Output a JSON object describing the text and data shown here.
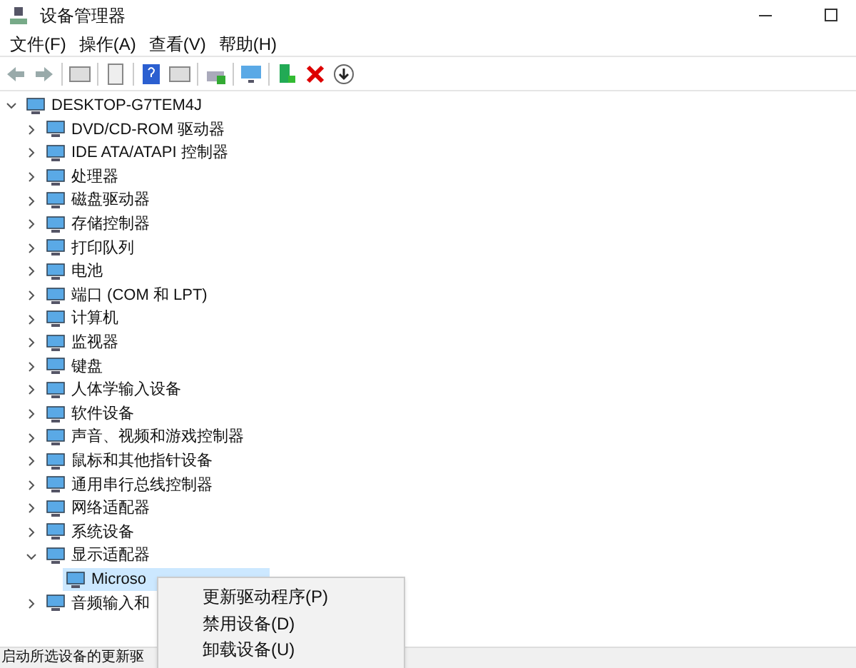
{
  "window": {
    "title": "设备管理器"
  },
  "menu_bar": [
    "文件(F)",
    "操作(A)",
    "查看(V)",
    "帮助(H)"
  ],
  "tree": {
    "label": "DESKTOP-G7TEM4J",
    "expanded": true,
    "children": [
      {
        "label": "DVD/CD-ROM 驱动器",
        "expanded": false
      },
      {
        "label": "IDE ATA/ATAPI 控制器",
        "expanded": false
      },
      {
        "label": "处理器",
        "expanded": false
      },
      {
        "label": "磁盘驱动器",
        "expanded": false
      },
      {
        "label": "存储控制器",
        "expanded": false
      },
      {
        "label": "打印队列",
        "expanded": false
      },
      {
        "label": "电池",
        "expanded": false
      },
      {
        "label": "端口 (COM 和 LPT)",
        "expanded": false
      },
      {
        "label": "计算机",
        "expanded": false
      },
      {
        "label": "监视器",
        "expanded": false
      },
      {
        "label": "键盘",
        "expanded": false
      },
      {
        "label": "人体学输入设备",
        "expanded": false
      },
      {
        "label": "软件设备",
        "expanded": false
      },
      {
        "label": "声音、视频和游戏控制器",
        "expanded": false
      },
      {
        "label": "鼠标和其他指针设备",
        "expanded": false
      },
      {
        "label": "通用串行总线控制器",
        "expanded": false
      },
      {
        "label": "网络适配器",
        "expanded": false
      },
      {
        "label": "系统设备",
        "expanded": false
      },
      {
        "label": "显示适配器",
        "expanded": true,
        "children": [
          {
            "label": "Microso",
            "selected": true
          }
        ]
      },
      {
        "label": "音频输入和",
        "expanded": false
      }
    ]
  },
  "context_menu": [
    "更新驱动程序(P)",
    "禁用设备(D)",
    "卸载设备(U)"
  ],
  "status_bar": "启动所选设备的更新驱"
}
